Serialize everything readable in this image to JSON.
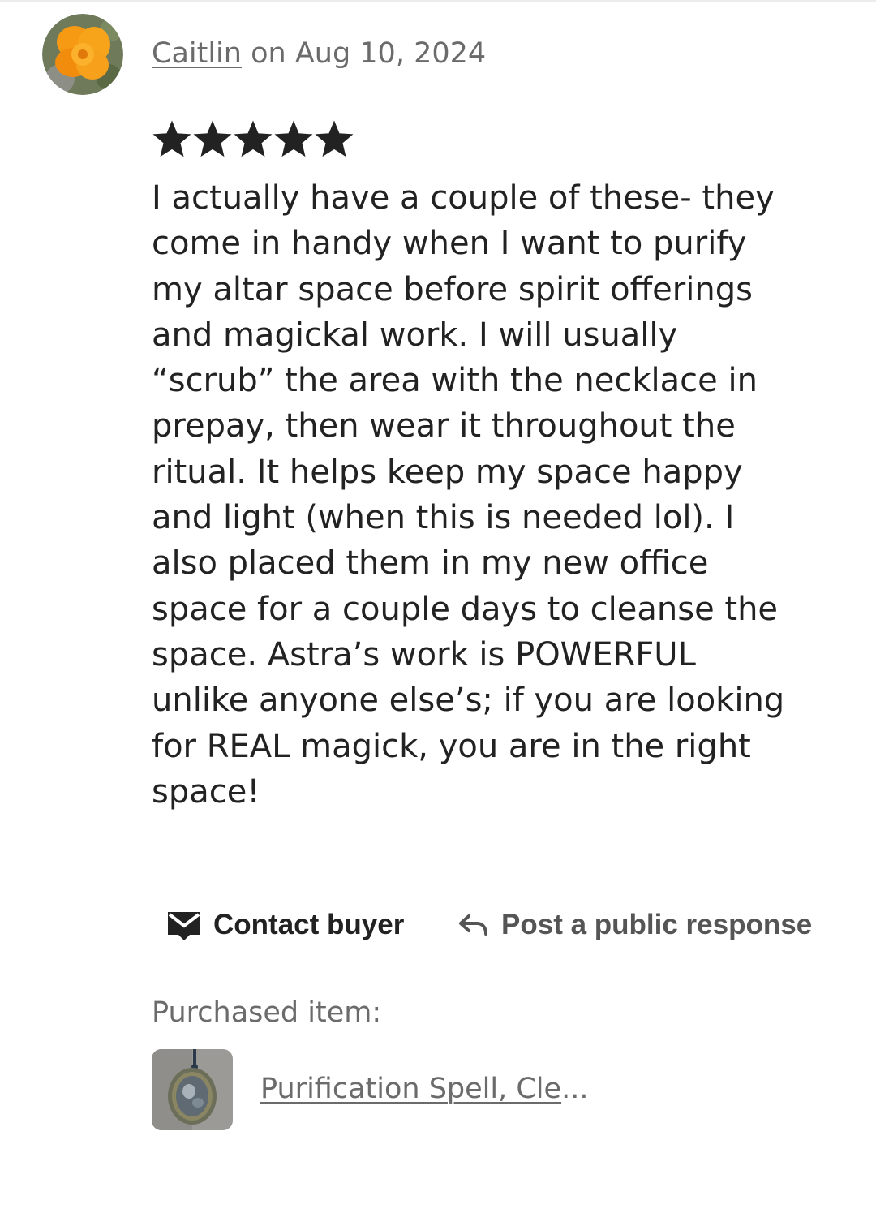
{
  "review": {
    "reviewer_name": "Caitlin",
    "date_text": " on Aug 10, 2024",
    "rating": 5,
    "rating_max": 5,
    "text": "I actually have a couple of these- they\ncome in handy when I want to purify\nmy altar space before spirit offerings\nand magickal work. I will usually\n“scrub” the area with the necklace in\nprepay, then wear it throughout the\nritual. It helps keep my space happy\nand light (when this is needed lol). I\nalso placed them in my new office\nspace for a couple days to cleanse the\nspace. Astra’s work is POWERFUL\nunlike anyone else’s; if you are looking\nfor REAL magick, you are in the right\nspace!"
  },
  "actions": {
    "contact_label": "Contact buyer",
    "contact_icon": "envelope-icon",
    "respond_label": "Post a public response",
    "respond_icon": "reply-arrow-icon"
  },
  "purchased": {
    "label": "Purchased item:",
    "item_title": "Purification Spell, Cle",
    "item_ellipsis": "..."
  },
  "colors": {
    "text_primary": "#222222",
    "text_secondary": "#6b6b6b",
    "star": "#222222"
  }
}
